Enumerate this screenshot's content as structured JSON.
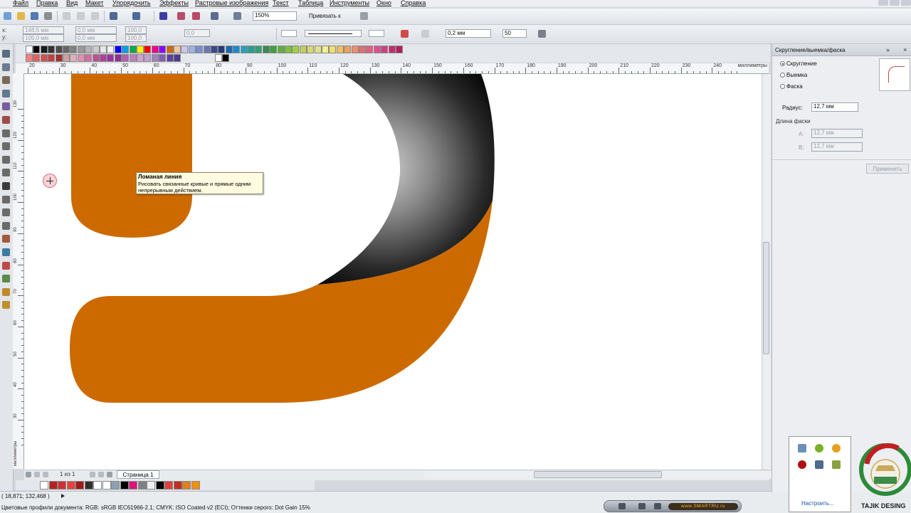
{
  "menu": {
    "items": [
      "Файл",
      "Правка",
      "Вид",
      "Макет",
      "Упорядочить",
      "Эффекты",
      "Растровые изображения",
      "Текст",
      "Таблица",
      "Инструменты",
      "Окно",
      "Справка"
    ]
  },
  "toolbar": {
    "zoom": "150%",
    "snap_label": "Привязать к",
    "pos_x": "148,5 мм",
    "pos_y": "105,0 мм",
    "size_w": "0,0 мм",
    "size_h": "0,0 мм",
    "scale_w": "100,0",
    "scale_h": "100,0",
    "angle": "0,0",
    "outline_width": "0,2 мм",
    "smoothing": "50",
    "x_label": "x:",
    "y_label": "y:"
  },
  "ruler": {
    "unit": "миллиметры",
    "unit_left": "миллиметры",
    "top_ticks": [
      "20",
      "30",
      "40",
      "50",
      "60",
      "70",
      "80",
      "90",
      "100",
      "110",
      "120",
      "130",
      "140",
      "150",
      "160",
      "170",
      "180",
      "190",
      "200",
      "210",
      "220",
      "230",
      "240"
    ],
    "left_ticks": [
      "130",
      "120",
      "110",
      "100",
      "90",
      "80",
      "70",
      "60",
      "50",
      "40",
      "30"
    ]
  },
  "tooltip": {
    "title": "Ломаная линия",
    "desc_line1": "Рисовать связанные кривые и прямые одним",
    "desc_line2": "непрерывным действием."
  },
  "pagebar": {
    "page_count": "1 из 1",
    "page_tab": "Страница 1"
  },
  "status": {
    "coords": "( 18,871; 132,468 )",
    "profiles": "Цветовые профили документа: RGB: sRGB IEC61966-2.1; CMYK: ISO Coated v2 (ECI); Оттенки серого: Dot Gain 15%"
  },
  "docker": {
    "title": "Скругление/выемка/фаска",
    "opt_round": "Скругление",
    "opt_scallop": "Выемка",
    "opt_chamfer": "Фаска",
    "radius_label": "Радиус:",
    "radius_value": "12,7 мм",
    "chamfer_label": "Длина фаски",
    "a_label": "A:",
    "a_value": "12,7 мм",
    "b_label": "B:",
    "b_value": "12,7 мм",
    "apply_label": "Применить"
  },
  "tray": {
    "customize": "Настроить..."
  },
  "media": {
    "site": "www.SMARTRU.ru"
  },
  "logo": {
    "text": "TAJIK DESING"
  },
  "colors": {
    "orange": "#cc6a00",
    "canvas": "#ffffff",
    "tooltip_bg": "#fffbe1"
  }
}
